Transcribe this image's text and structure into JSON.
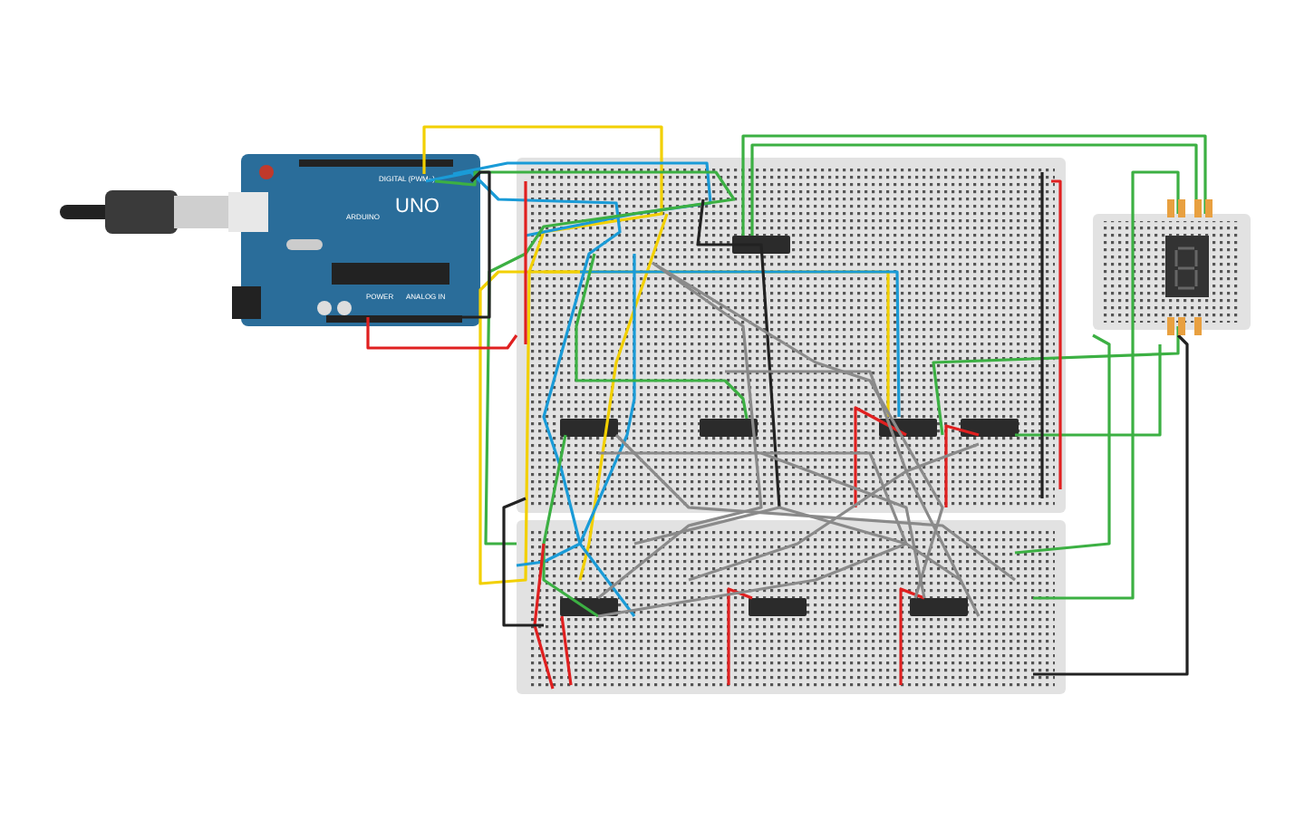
{
  "canvas": {
    "arduino": {
      "brand": "ARDUINO",
      "model": "UNO",
      "header_label": "DIGITAL (PWM~)",
      "power_label": "POWER",
      "analog_label": "ANALOG IN"
    }
  }
}
